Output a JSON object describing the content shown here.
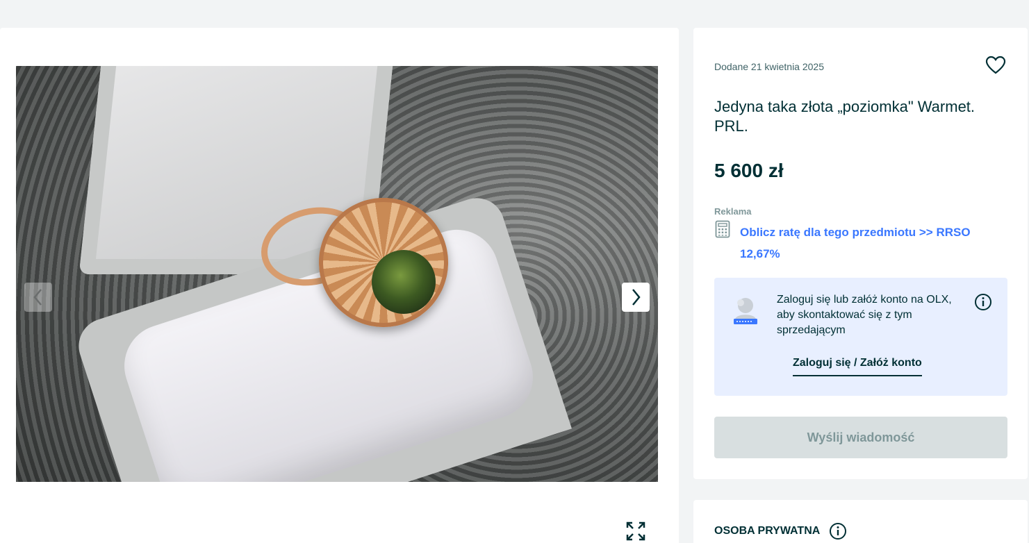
{
  "gallery": {
    "image_alt": "ring photo",
    "prev_icon": "chevron-left-icon",
    "next_icon": "chevron-right-icon",
    "fullscreen_icon": "expand-icon"
  },
  "listing": {
    "added_date": "Dodane 21 kwietnia 2025",
    "title": "Jedyna taka złota „poziomka\" Warmet. PRL.",
    "price": "5 600 zł",
    "favorite_icon": "heart-icon"
  },
  "financing": {
    "ad_label": "Reklama",
    "link_text": "Oblicz ratę dla tego przedmiotu >> RRSO 12,67%",
    "icon": "calculator-icon"
  },
  "login_prompt": {
    "text": "Zaloguj się lub załóż konto na OLX, aby skontaktować się z tym sprzedającym",
    "link_label": "Zaloguj się / Załóż konto",
    "icon": "info-icon"
  },
  "actions": {
    "send_message_label": "Wyślij wiadomość"
  },
  "seller": {
    "type_label": "OSOBA PRYWATNA"
  },
  "colors": {
    "page_bg": "#f2f4f5",
    "text_primary": "#002f34",
    "link_blue": "#3a77ff",
    "login_bg": "#e8efff",
    "disabled_btn_bg": "#d8dfe0"
  }
}
